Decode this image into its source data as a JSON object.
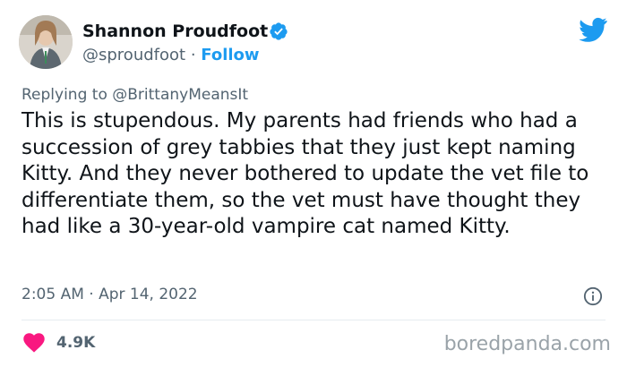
{
  "author": {
    "name": "Shannon Proudfoot",
    "handle": "@sproudfoot",
    "separator": "·",
    "follow_label": "Follow"
  },
  "reply": {
    "prefix": "Replying to",
    "target": "@BrittanyMeansIt"
  },
  "tweet": {
    "text": "This is stupendous. My parents had friends who had a succession of grey tabbies that they just kept naming Kitty. And they never bothered to update the vet file to differentiate them, so the vet must have thought they had like a 30-year-old vampire cat named Kitty."
  },
  "meta": {
    "time": "2:05 AM",
    "separator": "·",
    "date": "Apr 14, 2022"
  },
  "engagement": {
    "likes": "4.9K"
  },
  "watermark": "boredpanda.com",
  "icons": {
    "verified": "verified-badge-icon",
    "bird": "twitter-bird-icon",
    "info": "info-icon",
    "heart": "heart-icon"
  },
  "colors": {
    "accent": "#1d9bf0",
    "heart": "#f91880",
    "text": "#0f1419",
    "secondary": "#536471"
  }
}
